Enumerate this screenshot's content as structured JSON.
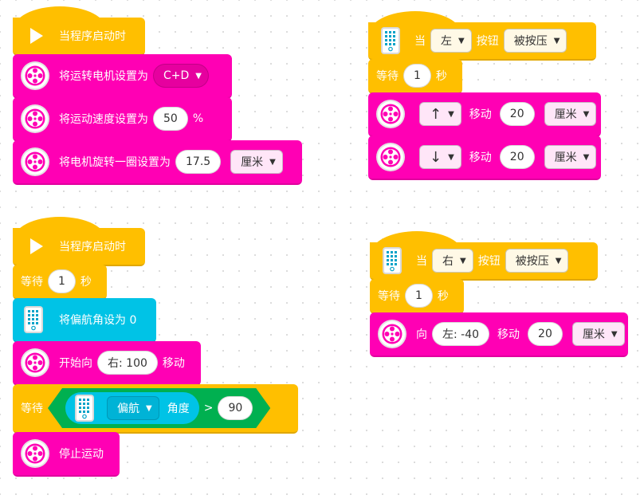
{
  "stack1": {
    "hat_label": "当程序启动时",
    "motor_pair_label": "将运转电机设置为",
    "motor_pair_value": "C+D",
    "speed_label": "将运动速度设置为",
    "speed_value": "50",
    "speed_unit": "%",
    "rotation_label": "将电机旋转一圈设置为",
    "rotation_value": "17.5",
    "rotation_unit": "厘米"
  },
  "stack2": {
    "hat_label": "当程序启动时",
    "wait_label": "等待",
    "wait_value": "1",
    "wait_unit": "秒",
    "yaw_label": "将偏航角设为 0",
    "start_label": "开始向",
    "start_value": "右: 100",
    "start_suffix": "移动",
    "wait2_label": "等待",
    "cond_sensor_option": "偏航",
    "cond_sensor_label": "角度",
    "cond_operator": ">",
    "cond_value": "90",
    "stop_label": "停止运动"
  },
  "stack3": {
    "when_label": "当",
    "button_option": "左",
    "button_label": "按钮",
    "button_state": "被按压",
    "wait_label": "等待",
    "wait_value": "1",
    "wait_unit": "秒",
    "move1_dir": "↑",
    "move1_label": "移动",
    "move1_value": "20",
    "move1_unit": "厘米",
    "move2_dir": "↓",
    "move2_label": "移动",
    "move2_value": "20",
    "move2_unit": "厘米"
  },
  "stack4": {
    "when_label": "当",
    "button_option": "右",
    "button_label": "按钮",
    "button_state": "被按压",
    "wait_label": "等待",
    "wait_value": "1",
    "wait_unit": "秒",
    "move_prefix": "向",
    "move_steer": "左: -40",
    "move_label": "移动",
    "move_value": "20",
    "move_unit": "厘米"
  },
  "icons": {
    "play": "play-icon",
    "motor": "motor-icon",
    "hub": "hub-icon",
    "caret": "chevron-down-icon"
  },
  "colors": {
    "motor": "#ff00b4",
    "event": "#ffbf00",
    "sensor": "#00c3e6",
    "operator": "#00b050"
  }
}
